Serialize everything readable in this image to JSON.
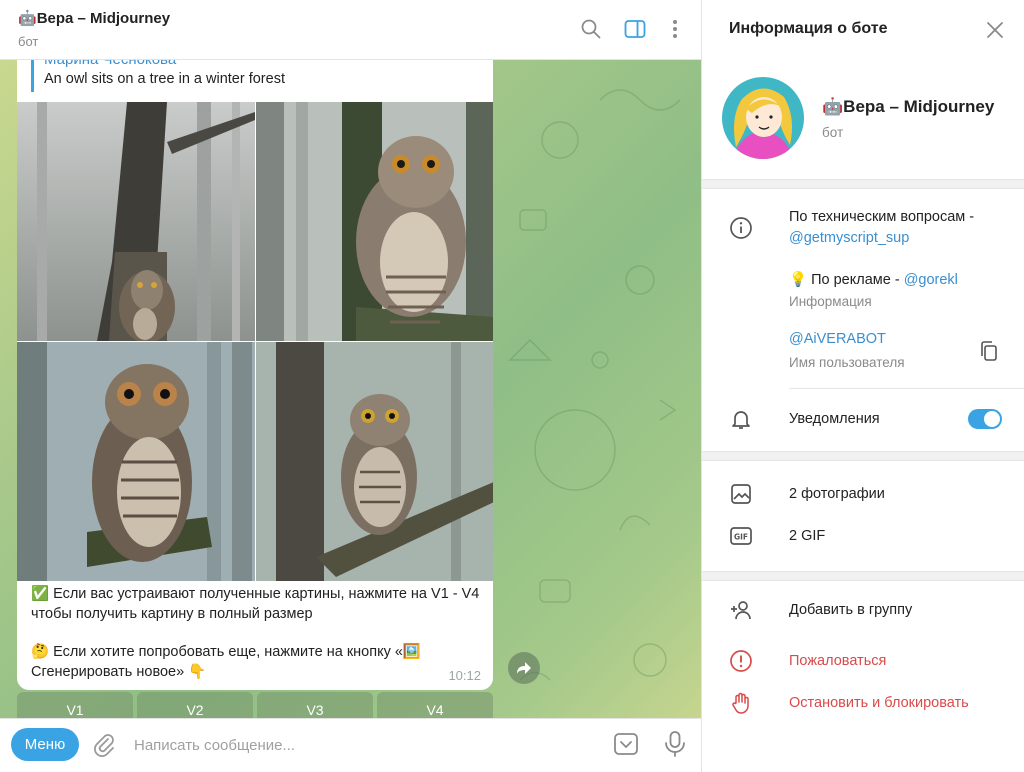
{
  "header": {
    "bot_emoji": "🤖",
    "title": "Вера – Midjourney",
    "subtitle": "бот"
  },
  "message": {
    "reply_author": "Марина Чеснокова",
    "reply_text": "An owl sits on a tree in a winter forest",
    "paragraph1": "✅ Если вас устраивают полученные картины, нажмите на V1 - V4 чтобы получить картину в полный размер",
    "paragraph2": "🤔 Если хотите попробовать еще, нажмите на кнопку «🖼️ Сгенерировать новое» 👇",
    "time": "10:12"
  },
  "keyboard": {
    "buttons": [
      "V1",
      "V2",
      "V3",
      "V4"
    ]
  },
  "composer": {
    "menu_label": "Меню",
    "placeholder": "Написать сообщение..."
  },
  "info": {
    "title": "Информация о боте",
    "bot_name": "🤖Вера – Midjourney",
    "bot_sub": "бот",
    "about_prefix": "По техническим вопросам -",
    "about_link": "@getmyscript_sup",
    "ads_prefix": "💡 По рекламе - ",
    "ads_link": "@gorekl",
    "about_caption": "Информация",
    "username": "@AiVERABOT",
    "username_caption": "Имя пользователя",
    "notifications": "Уведомления",
    "notifications_on": true,
    "photos": "2 фотографии",
    "gifs": "2 GIF",
    "add_group": "Добавить в группу",
    "report": "Пожаловаться",
    "block": "Остановить и блокировать"
  },
  "colors": {
    "accent": "#3aa3e3",
    "danger": "#d94a4a",
    "chat_bg": "#a4c98a"
  }
}
